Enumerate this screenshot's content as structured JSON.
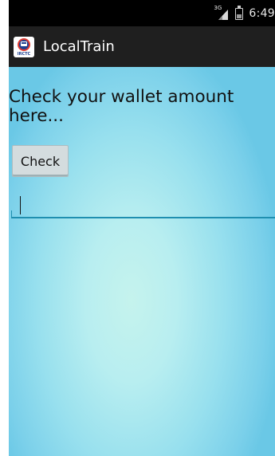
{
  "status_bar": {
    "network_type": "3G",
    "time": "6:49"
  },
  "action_bar": {
    "logo_text": "IRCTC",
    "title": "LocalTrain"
  },
  "main": {
    "heading": "Check your wallet amount here...",
    "check_button_label": "Check",
    "wallet_input": {
      "value": "",
      "placeholder": ""
    }
  },
  "colors": {
    "status_bar_bg": "#000000",
    "action_bar_bg": "#1f1f1f",
    "content_gradient_center": "#c5f3ed",
    "content_gradient_edge": "#6ac8e6",
    "input_underline": "#1f8fb0"
  },
  "icons": {
    "signal": "signal-icon",
    "battery": "battery-icon",
    "app_logo": "irctc-logo-icon"
  }
}
